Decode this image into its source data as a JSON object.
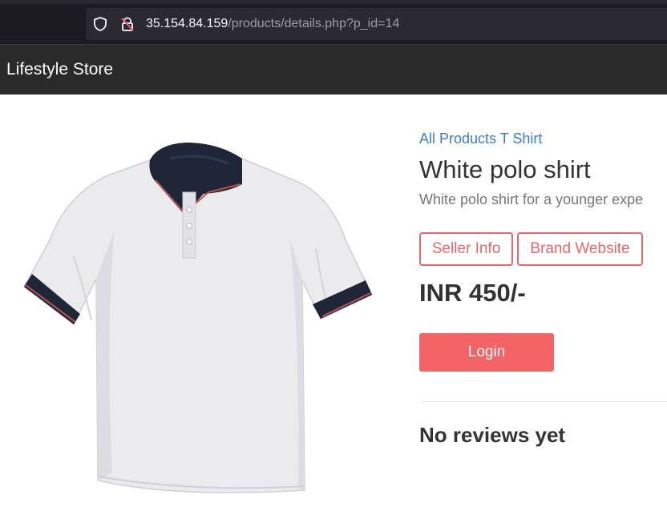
{
  "browser": {
    "url_host": "35.154.84.159",
    "url_path": "/products/details.php?p_id=14",
    "icons": [
      "shield-icon",
      "insecure-lock-icon"
    ]
  },
  "navbar": {
    "brand": "Lifestyle Store"
  },
  "product": {
    "image_icon": "polo-shirt-image",
    "breadcrumb": "All Products T Shirt",
    "title": "White polo shirt",
    "description": "White polo shirt for a younger expe",
    "seller_info_label": "Seller Info",
    "brand_website_label": "Brand Website",
    "price": "INR 450/-",
    "login_label": "Login",
    "reviews_heading": "No reviews yet"
  },
  "colors": {
    "accent": "#f46464",
    "outline_accent": "#e8686a",
    "link": "#3a7fc1",
    "navbar_bg": "#2a2a2a",
    "chrome_bg": "#1c1b22"
  }
}
